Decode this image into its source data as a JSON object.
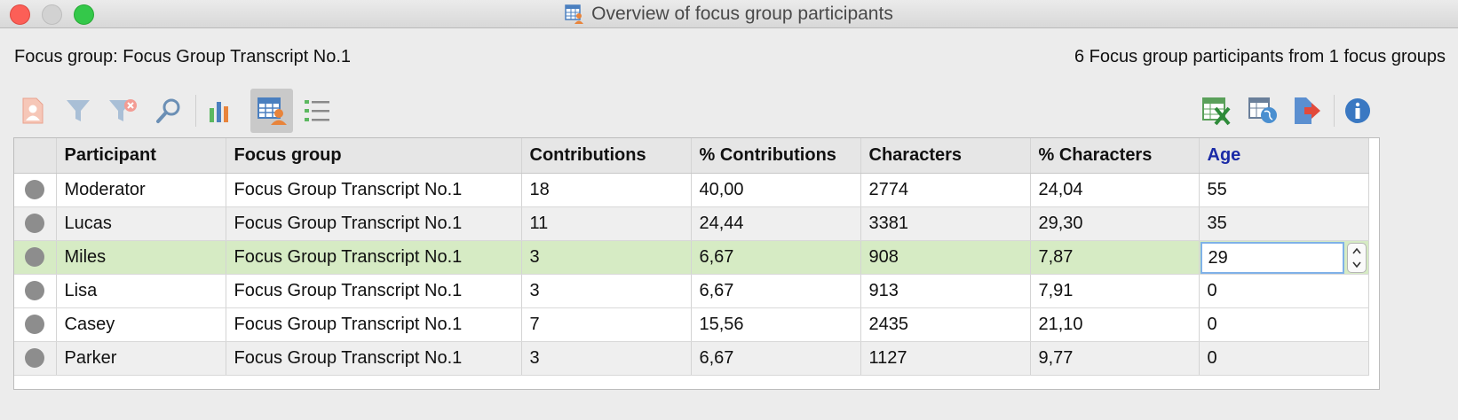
{
  "window": {
    "title": "Overview of focus group participants"
  },
  "info": {
    "focus_group_label": "Focus group: Focus Group Transcript No.1",
    "summary": "6 Focus group participants from 1 focus groups"
  },
  "toolbar": {
    "left_icons": [
      "participant-icon",
      "filter-icon",
      "filter-clear-icon",
      "search-icon",
      "bar-chart-icon",
      "table-view-icon",
      "list-view-icon"
    ],
    "right_icons": [
      "excel-export-icon",
      "web-export-icon",
      "export-icon",
      "info-icon"
    ],
    "colors": {
      "orange": "#e8843b",
      "blue": "#4a7fbf",
      "green": "#4caf50",
      "red": "#e24a3b"
    }
  },
  "table": {
    "columns": [
      "Participant",
      "Focus group",
      "Contributions",
      "% Contributions",
      "Characters",
      "% Characters",
      "Age"
    ],
    "rows": [
      {
        "participant": "Moderator",
        "focus_group": "Focus Group Transcript No.1",
        "contributions": "18",
        "pct_contributions": "40,00",
        "characters": "2774",
        "pct_characters": "24,04",
        "age": "55"
      },
      {
        "participant": "Lucas",
        "focus_group": "Focus Group Transcript No.1",
        "contributions": "11",
        "pct_contributions": "24,44",
        "characters": "3381",
        "pct_characters": "29,30",
        "age": "35"
      },
      {
        "participant": "Miles",
        "focus_group": "Focus Group Transcript No.1",
        "contributions": "3",
        "pct_contributions": "6,67",
        "characters": "908",
        "pct_characters": "7,87",
        "age": "29"
      },
      {
        "participant": "Lisa",
        "focus_group": "Focus Group Transcript No.1",
        "contributions": "3",
        "pct_contributions": "6,67",
        "characters": "913",
        "pct_characters": "7,91",
        "age": "0"
      },
      {
        "participant": "Casey",
        "focus_group": "Focus Group Transcript No.1",
        "contributions": "7",
        "pct_contributions": "15,56",
        "characters": "2435",
        "pct_characters": "21,10",
        "age": "0"
      },
      {
        "participant": "Parker",
        "focus_group": "Focus Group Transcript No.1",
        "contributions": "3",
        "pct_contributions": "6,67",
        "characters": "1127",
        "pct_characters": "9,77",
        "age": "0"
      }
    ],
    "selected_row": 2,
    "sorted_column": "Age",
    "selected_row_color": "#d6ebc4"
  }
}
